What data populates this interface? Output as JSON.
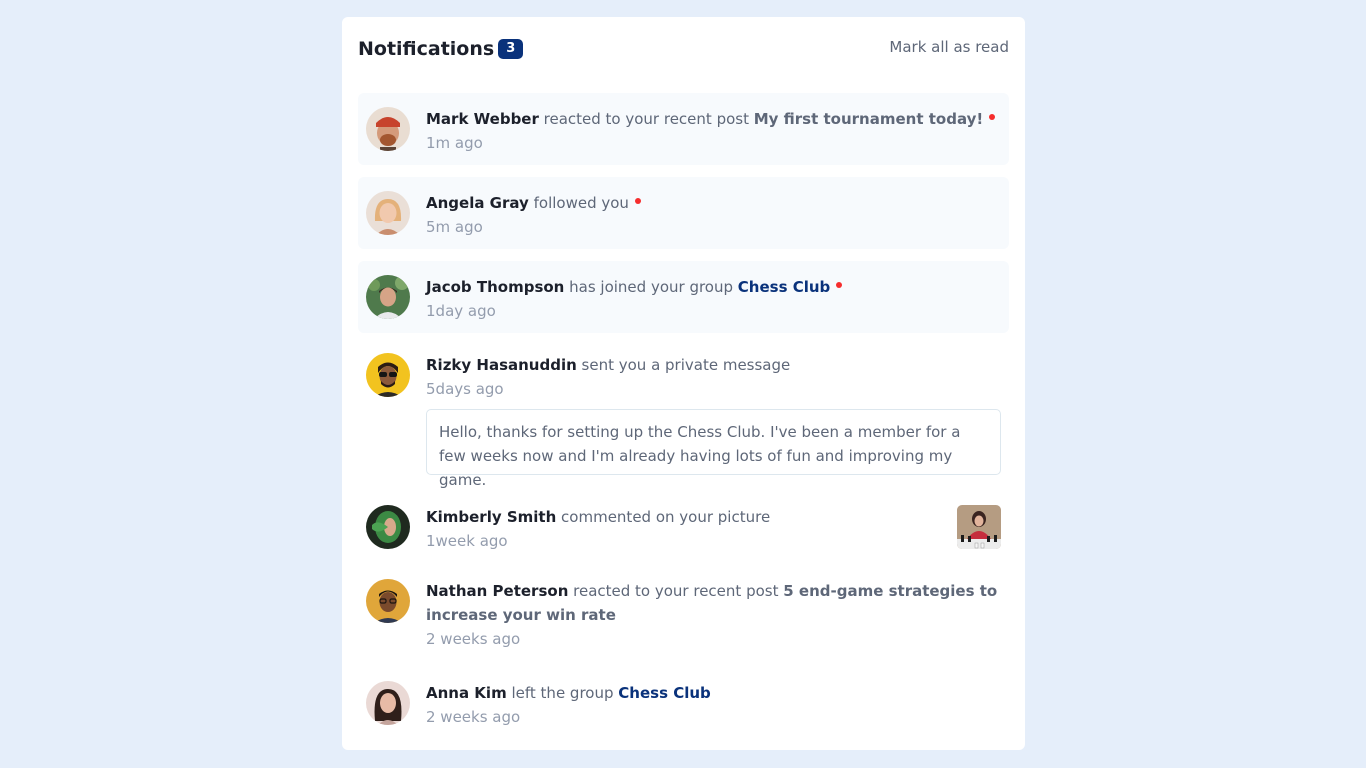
{
  "header": {
    "title": "Notifications",
    "unread_count": "3",
    "mark_all_label": "Mark all as read"
  },
  "notifications": [
    {
      "name": "Mark Webber",
      "action": " reacted to your recent post ",
      "post": "My first tournament today!",
      "time": "1m ago",
      "unread": true
    },
    {
      "name": "Angela Gray",
      "action": " followed you",
      "time": "5m ago",
      "unread": true
    },
    {
      "name": "Jacob Thompson",
      "action": " has joined your group ",
      "group": "Chess Club",
      "time": "1day ago",
      "unread": true
    },
    {
      "name": "Rizky Hasanuddin",
      "action": " sent you a private message",
      "time": "5days ago",
      "message": "Hello, thanks for setting up the Chess Club. I've been a member for a few weeks now and I'm already having lots of fun and improving my game.",
      "unread": false
    },
    {
      "name": "Kimberly Smith",
      "action": " commented on your picture",
      "time": "1week ago",
      "unread": false
    },
    {
      "name": "Nathan Peterson",
      "action": " reacted to your recent post ",
      "post": "5 end-game strategies to increase your win rate",
      "time": "2 weeks ago",
      "unread": false
    },
    {
      "name": "Anna Kim",
      "action": " left the group ",
      "group": "Chess Club",
      "time": "2 weeks ago",
      "unread": false
    }
  ],
  "colors": {
    "background": "#e5eefa",
    "navy": "#0a327b",
    "red_dot": "#f62d2d",
    "unread_bg": "#f7fafd"
  }
}
